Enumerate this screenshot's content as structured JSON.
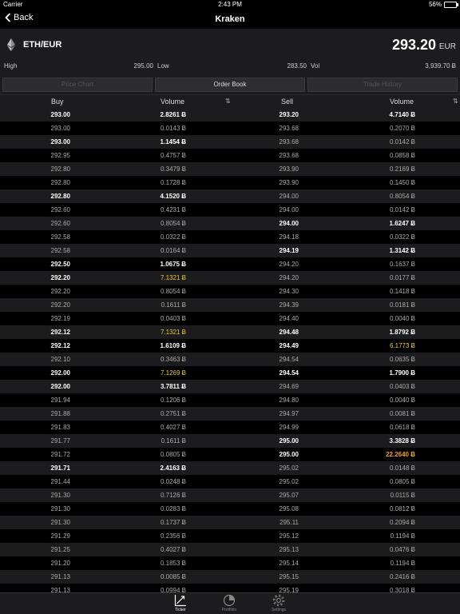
{
  "status": {
    "carrier": "Carrier",
    "time": "2:43 PM",
    "battery": "56%",
    "battery_level": 0.56
  },
  "nav": {
    "back_label": "Back",
    "title": "Kraken"
  },
  "pair": {
    "name": "ETH/EUR",
    "icon": "ethereum-icon",
    "price": "293.20",
    "currency": "EUR"
  },
  "stats": {
    "high_label": "High",
    "high_value": "295.00",
    "low_label": "Low",
    "low_value": "283.50",
    "vol_label": "Vol",
    "vol_value": "3,939.70 Ƀ"
  },
  "segments": {
    "price_chart": "Price Chart",
    "order_book": "Order Book",
    "trade_history": "Trade History",
    "selected": "Order Book"
  },
  "headers": {
    "buy": "Buy",
    "buy_volume": "Volume",
    "sell": "Sell",
    "sell_volume": "Volume",
    "sort_icon": "sort-arrows-icon"
  },
  "colors": {
    "bold": "#ffffff",
    "normal": "#aaaaaa",
    "highlight_yellow": "#e8c840",
    "highlight_orange": "#f0a030"
  },
  "rows": [
    {
      "buy": "293.00",
      "buy_vol": "2.8261 Ƀ",
      "buy_style": "b",
      "buy_vol_style": "b",
      "sell": "293.20",
      "sell_vol": "4.7140 Ƀ",
      "sell_style": "b",
      "sell_vol_style": "b"
    },
    {
      "buy": "293.00",
      "buy_vol": "0.0143 Ƀ",
      "buy_style": "n",
      "buy_vol_style": "n",
      "sell": "293.68",
      "sell_vol": "0.2070 Ƀ",
      "sell_style": "n",
      "sell_vol_style": "n"
    },
    {
      "buy": "293.00",
      "buy_vol": "1.1454 Ƀ",
      "buy_style": "b",
      "buy_vol_style": "b",
      "sell": "293.68",
      "sell_vol": "0.0142 Ƀ",
      "sell_style": "n",
      "sell_vol_style": "n"
    },
    {
      "buy": "292.95",
      "buy_vol": "0.4757 Ƀ",
      "buy_style": "n",
      "buy_vol_style": "n",
      "sell": "293.68",
      "sell_vol": "0.0858 Ƀ",
      "sell_style": "n",
      "sell_vol_style": "n"
    },
    {
      "buy": "292.80",
      "buy_vol": "0.3479 Ƀ",
      "buy_style": "n",
      "buy_vol_style": "n",
      "sell": "293.90",
      "sell_vol": "0.2169 Ƀ",
      "sell_style": "n",
      "sell_vol_style": "n"
    },
    {
      "buy": "292.80",
      "buy_vol": "0.1728 Ƀ",
      "buy_style": "n",
      "buy_vol_style": "n",
      "sell": "293.90",
      "sell_vol": "0.1450 Ƀ",
      "sell_style": "n",
      "sell_vol_style": "n"
    },
    {
      "buy": "292.80",
      "buy_vol": "4.1520 Ƀ",
      "buy_style": "b",
      "buy_vol_style": "b",
      "sell": "294.00",
      "sell_vol": "0.8054 Ƀ",
      "sell_style": "n",
      "sell_vol_style": "n"
    },
    {
      "buy": "292.60",
      "buy_vol": "0.4231 Ƀ",
      "buy_style": "n",
      "buy_vol_style": "n",
      "sell": "294.00",
      "sell_vol": "0.0142 Ƀ",
      "sell_style": "n",
      "sell_vol_style": "n"
    },
    {
      "buy": "292.60",
      "buy_vol": "0.8054 Ƀ",
      "buy_style": "n",
      "buy_vol_style": "n",
      "sell": "294.00",
      "sell_vol": "1.6247 Ƀ",
      "sell_style": "b",
      "sell_vol_style": "b"
    },
    {
      "buy": "292.58",
      "buy_vol": "0.0322 Ƀ",
      "buy_style": "n",
      "buy_vol_style": "n",
      "sell": "294.18",
      "sell_vol": "0.0322 Ƀ",
      "sell_style": "n",
      "sell_vol_style": "n"
    },
    {
      "buy": "292.58",
      "buy_vol": "0.0164 Ƀ",
      "buy_style": "n",
      "buy_vol_style": "n",
      "sell": "294.19",
      "sell_vol": "1.3142 Ƀ",
      "sell_style": "b",
      "sell_vol_style": "b"
    },
    {
      "buy": "292.50",
      "buy_vol": "1.0675 Ƀ",
      "buy_style": "b",
      "buy_vol_style": "b",
      "sell": "294.20",
      "sell_vol": "0.1637 Ƀ",
      "sell_style": "n",
      "sell_vol_style": "n"
    },
    {
      "buy": "292.20",
      "buy_vol": "7.1321 Ƀ",
      "buy_style": "b",
      "buy_vol_style": "y",
      "sell": "294.20",
      "sell_vol": "0.0177 Ƀ",
      "sell_style": "n",
      "sell_vol_style": "n"
    },
    {
      "buy": "292.20",
      "buy_vol": "0.8054 Ƀ",
      "buy_style": "n",
      "buy_vol_style": "n",
      "sell": "294.30",
      "sell_vol": "0.1418 Ƀ",
      "sell_style": "n",
      "sell_vol_style": "n"
    },
    {
      "buy": "292.20",
      "buy_vol": "0.1611 Ƀ",
      "buy_style": "n",
      "buy_vol_style": "n",
      "sell": "294.39",
      "sell_vol": "0.0181 Ƀ",
      "sell_style": "n",
      "sell_vol_style": "n"
    },
    {
      "buy": "292.19",
      "buy_vol": "0.0403 Ƀ",
      "buy_style": "n",
      "buy_vol_style": "n",
      "sell": "294.40",
      "sell_vol": "0.0040 Ƀ",
      "sell_style": "n",
      "sell_vol_style": "n"
    },
    {
      "buy": "292.12",
      "buy_vol": "7.1321 Ƀ",
      "buy_style": "b",
      "buy_vol_style": "y",
      "sell": "294.48",
      "sell_vol": "1.8792 Ƀ",
      "sell_style": "b",
      "sell_vol_style": "b"
    },
    {
      "buy": "292.12",
      "buy_vol": "1.6109 Ƀ",
      "buy_style": "b",
      "buy_vol_style": "b",
      "sell": "294.49",
      "sell_vol": "6.1773 Ƀ",
      "sell_style": "b",
      "sell_vol_style": "y"
    },
    {
      "buy": "292.10",
      "buy_vol": "0.3463 Ƀ",
      "buy_style": "n",
      "buy_vol_style": "n",
      "sell": "294.54",
      "sell_vol": "0.0635 Ƀ",
      "sell_style": "n",
      "sell_vol_style": "n"
    },
    {
      "buy": "292.00",
      "buy_vol": "7.1269 Ƀ",
      "buy_style": "b",
      "buy_vol_style": "y",
      "sell": "294.54",
      "sell_vol": "1.7900 Ƀ",
      "sell_style": "b",
      "sell_vol_style": "b"
    },
    {
      "buy": "292.00",
      "buy_vol": "3.7811 Ƀ",
      "buy_style": "b",
      "buy_vol_style": "b",
      "sell": "294.69",
      "sell_vol": "0.0403 Ƀ",
      "sell_style": "n",
      "sell_vol_style": "n"
    },
    {
      "buy": "291.94",
      "buy_vol": "0.1206 Ƀ",
      "buy_style": "n",
      "buy_vol_style": "n",
      "sell": "294.80",
      "sell_vol": "0.0040 Ƀ",
      "sell_style": "n",
      "sell_vol_style": "n"
    },
    {
      "buy": "291.88",
      "buy_vol": "0.2751 Ƀ",
      "buy_style": "n",
      "buy_vol_style": "n",
      "sell": "294.97",
      "sell_vol": "0.0081 Ƀ",
      "sell_style": "n",
      "sell_vol_style": "n"
    },
    {
      "buy": "291.83",
      "buy_vol": "0.4027 Ƀ",
      "buy_style": "n",
      "buy_vol_style": "n",
      "sell": "294.99",
      "sell_vol": "0.0618 Ƀ",
      "sell_style": "n",
      "sell_vol_style": "n"
    },
    {
      "buy": "291.77",
      "buy_vol": "0.1611 Ƀ",
      "buy_style": "n",
      "buy_vol_style": "n",
      "sell": "295.00",
      "sell_vol": "3.3828 Ƀ",
      "sell_style": "b",
      "sell_vol_style": "b"
    },
    {
      "buy": "291.72",
      "buy_vol": "0.0805 Ƀ",
      "buy_style": "n",
      "buy_vol_style": "n",
      "sell": "295.00",
      "sell_vol": "22.2640 Ƀ",
      "sell_style": "b",
      "sell_vol_style": "o"
    },
    {
      "buy": "291.71",
      "buy_vol": "2.4163 Ƀ",
      "buy_style": "b",
      "buy_vol_style": "b",
      "sell": "295.02",
      "sell_vol": "0.0148 Ƀ",
      "sell_style": "n",
      "sell_vol_style": "n"
    },
    {
      "buy": "291.44",
      "buy_vol": "0.0248 Ƀ",
      "buy_style": "n",
      "buy_vol_style": "n",
      "sell": "295.02",
      "sell_vol": "0.0805 Ƀ",
      "sell_style": "n",
      "sell_vol_style": "n"
    },
    {
      "buy": "291.30",
      "buy_vol": "0.7126 Ƀ",
      "buy_style": "n",
      "buy_vol_style": "n",
      "sell": "295.07",
      "sell_vol": "0.0115 Ƀ",
      "sell_style": "n",
      "sell_vol_style": "n"
    },
    {
      "buy": "291.30",
      "buy_vol": "0.0283 Ƀ",
      "buy_style": "n",
      "buy_vol_style": "n",
      "sell": "295.08",
      "sell_vol": "0.0812 Ƀ",
      "sell_style": "n",
      "sell_vol_style": "n"
    },
    {
      "buy": "291.30",
      "buy_vol": "0.1737 Ƀ",
      "buy_style": "n",
      "buy_vol_style": "n",
      "sell": "295.11",
      "sell_vol": "0.2094 Ƀ",
      "sell_style": "n",
      "sell_vol_style": "n"
    },
    {
      "buy": "291.29",
      "buy_vol": "0.2356 Ƀ",
      "buy_style": "n",
      "buy_vol_style": "n",
      "sell": "295.12",
      "sell_vol": "0.1194 Ƀ",
      "sell_style": "n",
      "sell_vol_style": "n"
    },
    {
      "buy": "291.25",
      "buy_vol": "0.4027 Ƀ",
      "buy_style": "n",
      "buy_vol_style": "n",
      "sell": "295.13",
      "sell_vol": "0.0476 Ƀ",
      "sell_style": "n",
      "sell_vol_style": "n"
    },
    {
      "buy": "291.20",
      "buy_vol": "0.1853 Ƀ",
      "buy_style": "n",
      "buy_vol_style": "n",
      "sell": "295.14",
      "sell_vol": "0.1194 Ƀ",
      "sell_style": "n",
      "sell_vol_style": "n"
    },
    {
      "buy": "291.13",
      "buy_vol": "0.0085 Ƀ",
      "buy_style": "n",
      "buy_vol_style": "n",
      "sell": "295.15",
      "sell_vol": "0.2416 Ƀ",
      "sell_style": "n",
      "sell_vol_style": "n"
    },
    {
      "buy": "291.13",
      "buy_vol": "0.0994 Ƀ",
      "buy_style": "n",
      "buy_vol_style": "n",
      "sell": "295.19",
      "sell_vol": "0.3018 Ƀ",
      "sell_style": "n",
      "sell_vol_style": "n"
    }
  ],
  "tabs": [
    {
      "label": "Ticker",
      "icon": "chart-line-icon",
      "active": true
    },
    {
      "label": "Portfolio",
      "icon": "pie-chart-icon",
      "active": false
    },
    {
      "label": "Settings",
      "icon": "gear-icon",
      "active": false
    }
  ]
}
